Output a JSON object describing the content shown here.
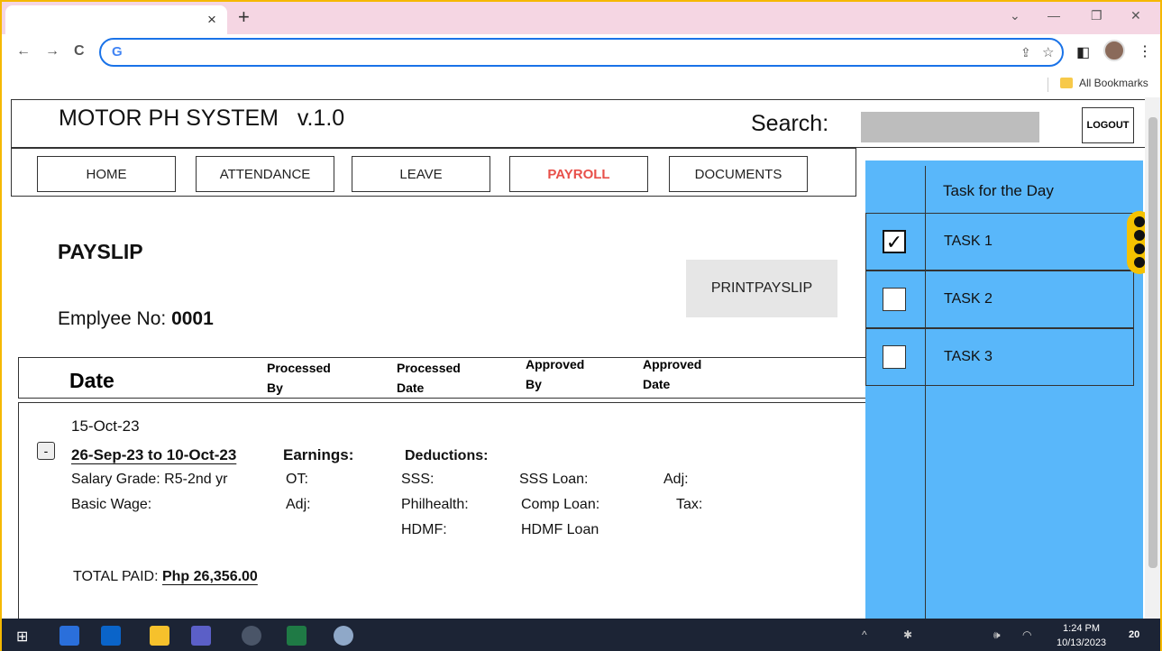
{
  "browser": {
    "tab_close": "×",
    "new_tab": "+",
    "window_controls": [
      "⌄",
      "—",
      "❐",
      "✕"
    ],
    "nav": {
      "back": "←",
      "forward": "→",
      "reload": "C"
    },
    "google_logo": "G",
    "address": "",
    "bookmarks_label": "All Bookmarks"
  },
  "app": {
    "title": "MOTOR PH SYSTEM   v.1.0",
    "search_label": "Search:",
    "search_value": "",
    "logout_label": "LOGOUT"
  },
  "nav": {
    "items": [
      {
        "label": "HOME",
        "active": false
      },
      {
        "label": "ATTENDANCE",
        "active": false
      },
      {
        "label": "LEAVE",
        "active": false
      },
      {
        "label": "PAYROLL",
        "active": true
      },
      {
        "label": "DOCUMENTS",
        "active": false
      }
    ]
  },
  "payslip": {
    "title": "PAYSLIP",
    "print_label_1": "PRINT",
    "print_label_2": "PAYSLIP",
    "employee_label": "Emplyee No: ",
    "employee_no": "0001",
    "columns": {
      "date": "Date",
      "processed_by_1": "Processed",
      "processed_by_2": "By",
      "processed_date_1": "Processed",
      "processed_date_2": "Date",
      "approved_by_1": "Approved",
      "approved_by_2": "By",
      "approved_date_1": "Approved",
      "approved_date_2": "Date"
    },
    "entry": {
      "collapse": "-",
      "date": "15-Oct-23",
      "period": "26-Sep-23 to 10-Oct-23",
      "salary_grade": "Salary Grade: R5-2nd yr",
      "basic_wage": "Basic Wage:",
      "earnings_label": "Earnings:",
      "ot": "OT:",
      "adj_earn": "Adj:",
      "deductions_label": "Deductions:",
      "sss": "SSS:",
      "philhealth": "Philhealth:",
      "hdmf": "HDMF:",
      "sss_loan": "SSS Loan:",
      "comp_loan": "Comp Loan:",
      "hdmf_loan": "HDMF Loan",
      "adj_ded": "Adj:",
      "tax": "Tax:",
      "total_label": "TOTAL PAID: ",
      "total_value": "Php 26,356.00"
    }
  },
  "tasks": {
    "header": "Task for the Day",
    "items": [
      {
        "label": "TASK 1",
        "checked": true,
        "mark": "✓"
      },
      {
        "label": "TASK 2",
        "checked": false,
        "mark": ""
      },
      {
        "label": "TASK 3",
        "checked": false,
        "mark": ""
      }
    ]
  },
  "taskbar": {
    "time": "1:24 PM",
    "date": "10/13/2023",
    "notification_count": "20"
  }
}
